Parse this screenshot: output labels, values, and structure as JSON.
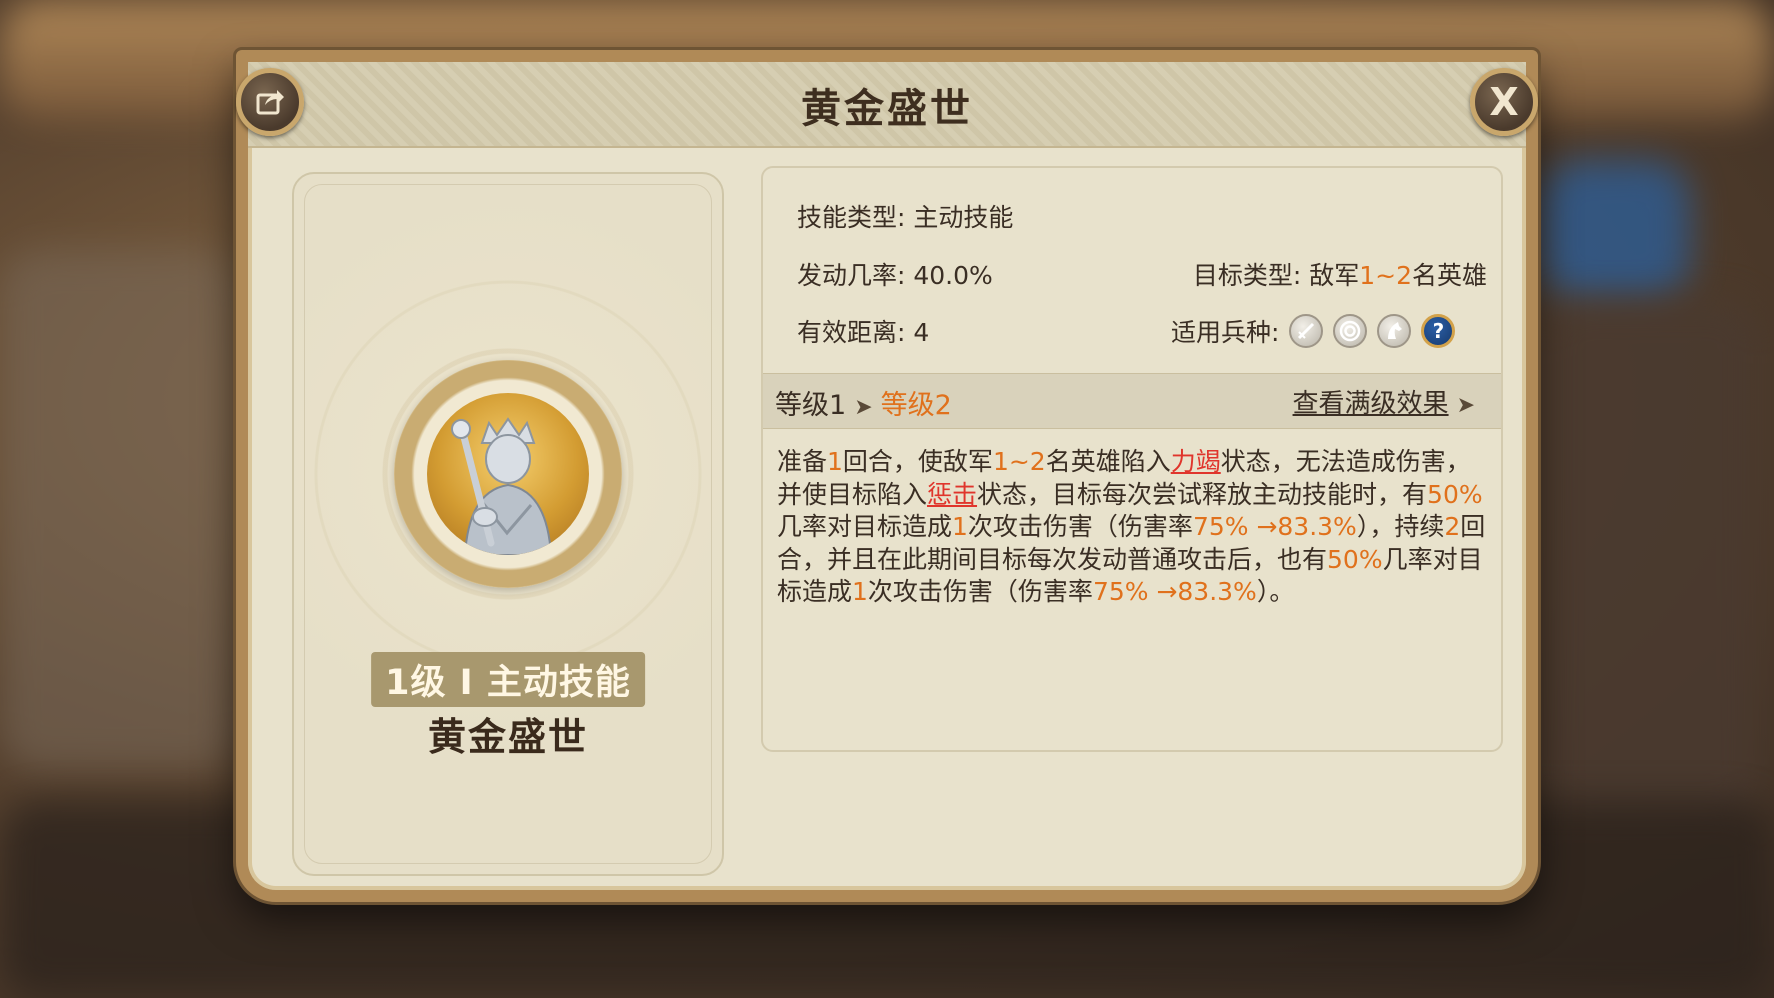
{
  "dialog": {
    "title": "黄金盛世",
    "share_icon": "share-icon",
    "close_label": "X"
  },
  "skill_card": {
    "level_badge": "1级 I 主动技能",
    "name": "黄金盛世",
    "portrait_icon": "king-with-scepter-portrait"
  },
  "info": {
    "skill_type": "技能类型: 主动技能",
    "trigger_rate": "发动几率: 40.0%",
    "effective_range": "有效距离: 4",
    "target_type_label": "目标类型: 敌军",
    "target_range": "1~2",
    "target_suffix": "名英雄",
    "applicable_units_label": "适用兵种:",
    "unit_icons": [
      "sword-icon",
      "target-icon",
      "cavalry-horse-icon",
      "question-icon"
    ],
    "unit_question": "?"
  },
  "level_bar": {
    "current": "等级1",
    "arrow": "➤",
    "next": "等级2",
    "view_max": "查看满级效果",
    "link_arrow": "➤"
  },
  "description": {
    "segments": [
      {
        "t": "准备",
        "s": "n"
      },
      {
        "t": "1",
        "s": "o"
      },
      {
        "t": "回合，使敌军",
        "s": "n"
      },
      {
        "t": "1~2",
        "s": "o"
      },
      {
        "t": "名英雄陷入",
        "s": "n"
      },
      {
        "t": "力竭",
        "s": "r"
      },
      {
        "t": "状态，无法造成伤害，并使目标陷入",
        "s": "n"
      },
      {
        "t": "惩击",
        "s": "r"
      },
      {
        "t": "状态，目标每次尝试释放主动技能时，有",
        "s": "n"
      },
      {
        "t": "50%",
        "s": "o"
      },
      {
        "t": "几率对目标造成",
        "s": "n"
      },
      {
        "t": "1",
        "s": "o"
      },
      {
        "t": "次攻击伤害（伤害率",
        "s": "n"
      },
      {
        "t": "75% →83.3%",
        "s": "o"
      },
      {
        "t": "），持续",
        "s": "n"
      },
      {
        "t": "2",
        "s": "o"
      },
      {
        "t": "回合，并且在此期间目标每次发动普通攻击后，也有",
        "s": "n"
      },
      {
        "t": "50%",
        "s": "o"
      },
      {
        "t": "几率对目标造成",
        "s": "n"
      },
      {
        "t": "1",
        "s": "o"
      },
      {
        "t": "次攻击伤害（伤害率",
        "s": "n"
      },
      {
        "t": "75% →83.3%",
        "s": "o"
      },
      {
        "t": "）。",
        "s": "n"
      }
    ]
  },
  "colors": {
    "accent_orange": "#e0711c",
    "status_red": "#e0352c",
    "panel_bg": "#e8e2cc",
    "frame_gold": "#b08a57"
  }
}
